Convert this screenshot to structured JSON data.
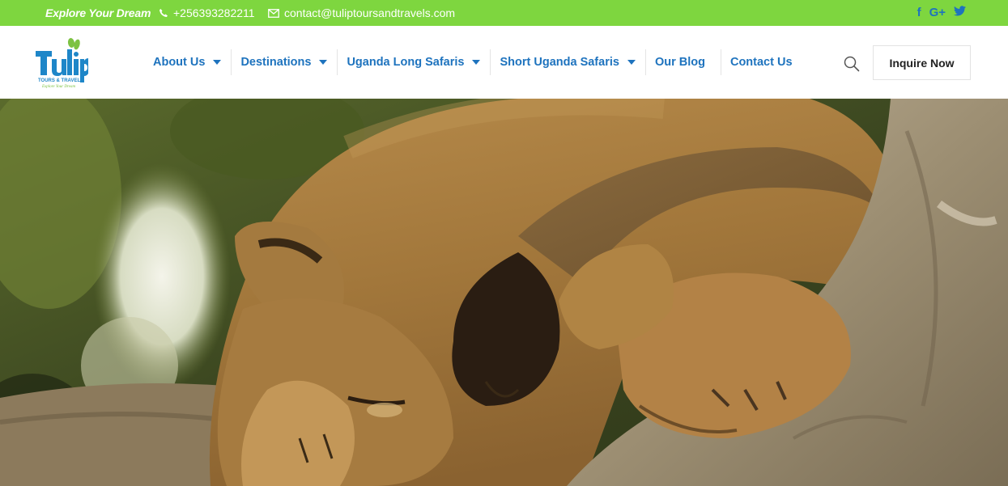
{
  "topbar": {
    "tagline": "Explore Your Dream",
    "phone": "+256393282211",
    "email": "contact@tuliptoursandtravels.com",
    "social": [
      {
        "icon": "facebook-icon",
        "glyph": "f"
      },
      {
        "icon": "google-plus-icon",
        "glyph": "G+"
      },
      {
        "icon": "twitter-icon",
        "glyph": "t"
      }
    ],
    "colors": {
      "bar": "#7ed63f",
      "text": "#ffffff",
      "social": "#1e73be"
    }
  },
  "logo": {
    "word": "Tulip",
    "line1": "TOURS & TRAVEL",
    "line2": "Explore Your Dream",
    "colors": {
      "blue": "#1e86c8",
      "green": "#7dc242"
    }
  },
  "nav": {
    "items": [
      {
        "label": "About Us",
        "dropdown": true
      },
      {
        "label": "Destinations",
        "dropdown": true
      },
      {
        "label": "Uganda Long Safaris",
        "dropdown": true
      },
      {
        "label": "Short Uganda Safaris",
        "dropdown": true
      },
      {
        "label": "Our Blog",
        "dropdown": false
      },
      {
        "label": "Contact Us",
        "dropdown": false
      }
    ],
    "color": "#1e73be"
  },
  "header": {
    "search_icon": "search-icon",
    "cta_label": "Inquire Now"
  },
  "hero": {
    "subject": "lioness resting on tree branch",
    "palette": {
      "fur": "#b5853f",
      "bark": "#a29479",
      "foliage": "#4b5a26"
    }
  }
}
